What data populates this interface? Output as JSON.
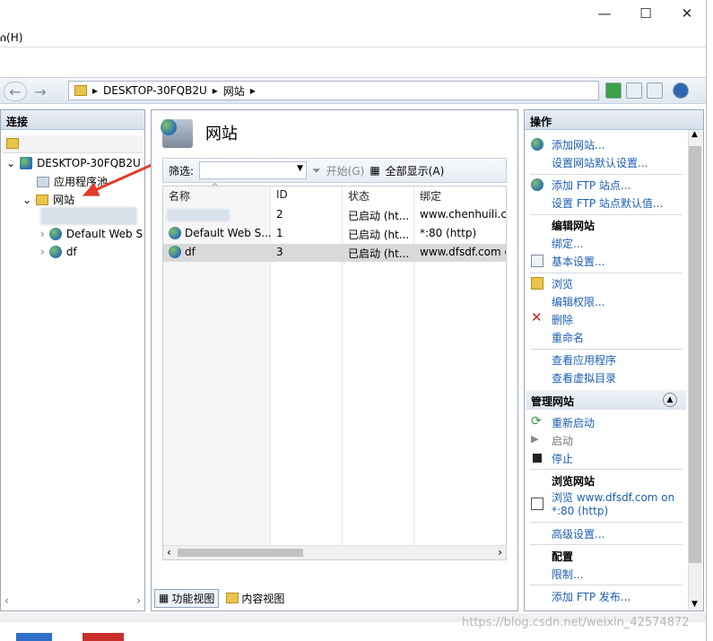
{
  "menubar": {
    "help": "ሰ(H)"
  },
  "window_controls": {
    "minimize": "—",
    "maximize": "☐",
    "close": "✕"
  },
  "address": {
    "crumbs": [
      "DESKTOP-30FQB2U",
      "网站"
    ]
  },
  "left": {
    "title": "连接",
    "tree": {
      "server": "DESKTOP-30FQB2U",
      "apppools": "应用程序池",
      "sites": "网站",
      "site_default": "Default Web S",
      "site_df": "df"
    }
  },
  "center": {
    "title": "网站",
    "filter": {
      "label": "筛选:",
      "start": "开始(G)",
      "show_all": "全部显示(A)"
    },
    "columns": [
      "名称",
      "ID",
      "状态",
      "绑定"
    ],
    "rows": [
      {
        "name": "",
        "id": "2",
        "status": "已启动 (ht...",
        "binding": "www.chenhuili.co"
      },
      {
        "name": "Default Web S...",
        "id": "1",
        "status": "已启动 (ht...",
        "binding": "*:80 (http)"
      },
      {
        "name": "df",
        "id": "3",
        "status": "已启动 (ht...",
        "binding": "www.dfsdf.com c"
      }
    ],
    "tabs": {
      "features": "功能视图",
      "content": "内容视图"
    }
  },
  "right": {
    "title": "操作",
    "add_site": "添加网站...",
    "site_defaults": "设置网站默认设置...",
    "add_ftp": "添加 FTP 站点...",
    "ftp_defaults": "设置 FTP 站点默认值...",
    "edit_site": "编辑网站",
    "bindings": "绑定...",
    "basic_settings": "基本设置...",
    "explore": "浏览",
    "edit_permissions": "编辑权限...",
    "delete": "删除",
    "rename": "重命名",
    "view_apps": "查看应用程序",
    "view_vdirs": "查看虚拟目录",
    "manage_site": "管理网站",
    "restart": "重新启动",
    "start": "启动",
    "stop": "停止",
    "browse_site": "浏览网站",
    "browse_link_1": "浏览 www.dfsdf.com on",
    "browse_link_2": "*:80 (http)",
    "advanced_settings": "高级设置...",
    "config": "配置",
    "limits": "限制...",
    "add_ftp_publish": "添加 FTP 发布..."
  },
  "watermark": "https://blog.csdn.net/weixin_42574872",
  "colors": {
    "link": "#1a5fb4",
    "selection": "#d9d9d9",
    "accent_red": "#e23b2b"
  }
}
